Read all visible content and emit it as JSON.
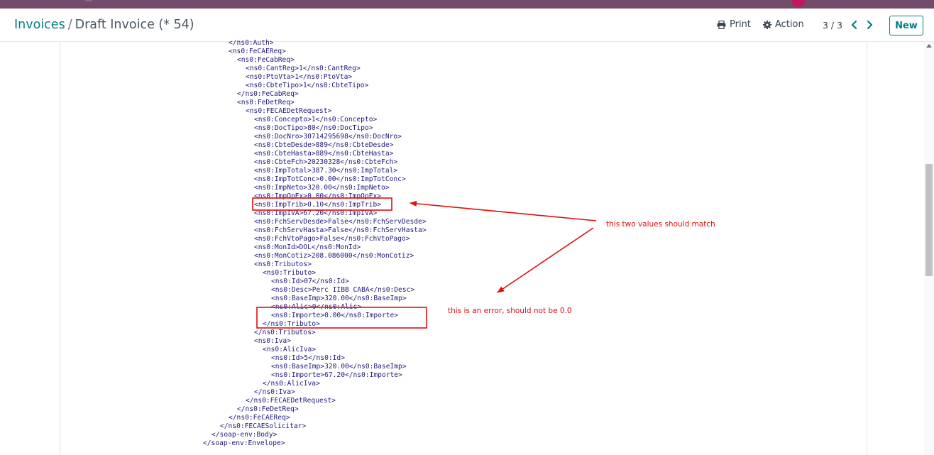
{
  "header": {
    "breadcrumb_parent": "Invoices",
    "breadcrumb_separator": "/",
    "breadcrumb_current": "Draft Invoice (* 54)",
    "print_label": "Print",
    "action_label": "Action",
    "pager_text": "3 / 3",
    "new_label": "New"
  },
  "xml_lines": [
    {
      "indent": 3,
      "text": "</ns0:Auth>"
    },
    {
      "indent": 3,
      "text": "<ns0:FeCAEReq>"
    },
    {
      "indent": 4,
      "text": "<ns0:FeCabReq>"
    },
    {
      "indent": 5,
      "text": "<ns0:CantReg>1</ns0:CantReg>"
    },
    {
      "indent": 5,
      "text": "<ns0:PtoVta>1</ns0:PtoVta>"
    },
    {
      "indent": 5,
      "text": "<ns0:CbteTipo>1</ns0:CbteTipo>"
    },
    {
      "indent": 4,
      "text": "</ns0:FeCabReq>"
    },
    {
      "indent": 4,
      "text": "<ns0:FeDetReq>"
    },
    {
      "indent": 5,
      "text": "<ns0:FECAEDetRequest>"
    },
    {
      "indent": 6,
      "text": "<ns0:Concepto>1</ns0:Concepto>"
    },
    {
      "indent": 6,
      "text": "<ns0:DocTipo>80</ns0:DocTipo>"
    },
    {
      "indent": 6,
      "text": "<ns0:DocNro>30714295698</ns0:DocNro>"
    },
    {
      "indent": 6,
      "text": "<ns0:CbteDesde>889</ns0:CbteDesde>"
    },
    {
      "indent": 6,
      "text": "<ns0:CbteHasta>889</ns0:CbteHasta>"
    },
    {
      "indent": 6,
      "text": "<ns0:CbteFch>20230328</ns0:CbteFch>"
    },
    {
      "indent": 6,
      "text": "<ns0:ImpTotal>387.30</ns0:ImpTotal>"
    },
    {
      "indent": 6,
      "text": "<ns0:ImpTotConc>0.00</ns0:ImpTotConc>"
    },
    {
      "indent": 6,
      "text": "<ns0:ImpNeto>320.00</ns0:ImpNeto>"
    },
    {
      "indent": 6,
      "text": "<ns0:ImpOpEx>0.00</ns0:ImpOpEx>"
    },
    {
      "indent": 6,
      "text": "<ns0:ImpTrib>0.10</ns0:ImpTrib>"
    },
    {
      "indent": 6,
      "text": "<ns0:ImpIVA>67.20</ns0:ImpIVA>"
    },
    {
      "indent": 6,
      "text": "<ns0:FchServDesde>False</ns0:FchServDesde>"
    },
    {
      "indent": 6,
      "text": "<ns0:FchServHasta>False</ns0:FchServHasta>"
    },
    {
      "indent": 6,
      "text": "<ns0:FchVtoPago>False</ns0:FchVtoPago>"
    },
    {
      "indent": 6,
      "text": "<ns0:MonId>DOL</ns0:MonId>"
    },
    {
      "indent": 6,
      "text": "<ns0:MonCotiz>208.086000</ns0:MonCotiz>"
    },
    {
      "indent": 6,
      "text": "<ns0:Tributos>"
    },
    {
      "indent": 7,
      "text": "<ns0:Tributo>"
    },
    {
      "indent": 8,
      "text": "<ns0:Id>07</ns0:Id>"
    },
    {
      "indent": 8,
      "text": "<ns0:Desc>Perc IIBB CABA</ns0:Desc>"
    },
    {
      "indent": 8,
      "text": "<ns0:BaseImp>320.00</ns0:BaseImp>"
    },
    {
      "indent": 8,
      "text": "<ns0:Alic>0</ns0:Alic>"
    },
    {
      "indent": 8,
      "text": "<ns0:Importe>0.00</ns0:Importe>"
    },
    {
      "indent": 7,
      "text": "</ns0:Tributo>"
    },
    {
      "indent": 6,
      "text": "</ns0:Tributos>"
    },
    {
      "indent": 6,
      "text": "<ns0:Iva>"
    },
    {
      "indent": 7,
      "text": "<ns0:AlicIva>"
    },
    {
      "indent": 8,
      "text": "<ns0:Id>5</ns0:Id>"
    },
    {
      "indent": 8,
      "text": "<ns0:BaseImp>320.00</ns0:BaseImp>"
    },
    {
      "indent": 8,
      "text": "<ns0:Importe>67.20</ns0:Importe>"
    },
    {
      "indent": 7,
      "text": "</ns0:AlicIva>"
    },
    {
      "indent": 6,
      "text": "</ns0:Iva>"
    },
    {
      "indent": 5,
      "text": "</ns0:FECAEDetRequest>"
    },
    {
      "indent": 4,
      "text": "</ns0:FeDetReq>"
    },
    {
      "indent": 3,
      "text": "</ns0:FeCAEReq>"
    },
    {
      "indent": 2,
      "text": "</ns0:FECAESolicitar>"
    },
    {
      "indent": 1,
      "text": "</soap-env:Body>"
    },
    {
      "indent": 0,
      "text": "</soap-env:Envelope>"
    }
  ],
  "annotations": {
    "note_match": "this two values should match",
    "note_error": "this is an error, should not be 0.0",
    "color": "#e10e0e"
  },
  "colors": {
    "brand_nav": "#714B67",
    "link_teal": "#017e84",
    "xml_text": "#1e1a7a"
  },
  "icons": {
    "print": "printer-icon",
    "action": "gear-icon",
    "prev": "chevron-left-icon",
    "next": "chevron-right-icon"
  }
}
